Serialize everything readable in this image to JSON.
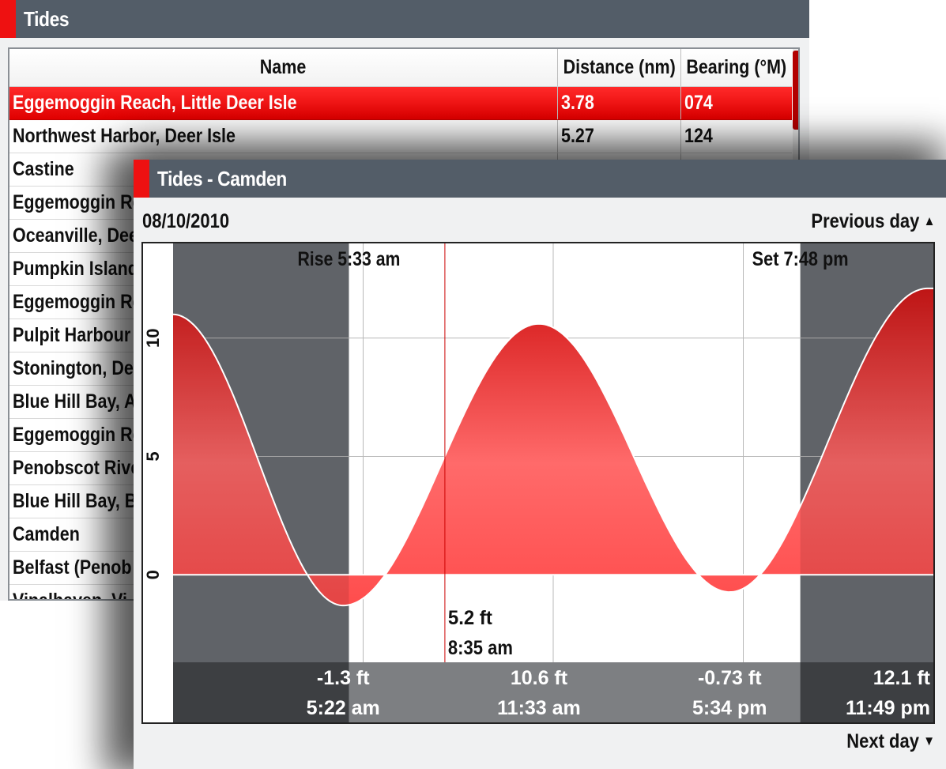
{
  "list_window": {
    "title": "Tides",
    "columns": [
      "Name",
      "Distance (nm)",
      "Bearing (°M)"
    ],
    "rows": [
      {
        "name": "Eggemoggin Reach, Little Deer Isle",
        "distance": "3.78",
        "bearing": "074",
        "selected": true
      },
      {
        "name": "Northwest Harbor, Deer Isle",
        "distance": "5.27",
        "bearing": "124"
      },
      {
        "name": "Castine",
        "distance": "",
        "bearing": ""
      },
      {
        "name": "Eggemoggin Re",
        "distance": "",
        "bearing": ""
      },
      {
        "name": "Oceanville, Dee",
        "distance": "",
        "bearing": ""
      },
      {
        "name": "Pumpkin Island",
        "distance": "",
        "bearing": ""
      },
      {
        "name": "Eggemoggin Re",
        "distance": "",
        "bearing": ""
      },
      {
        "name": "Pulpit Harbour",
        "distance": "",
        "bearing": ""
      },
      {
        "name": "Stonington, De",
        "distance": "",
        "bearing": ""
      },
      {
        "name": "Blue Hill Bay, A",
        "distance": "",
        "bearing": ""
      },
      {
        "name": "Eggemoggin Re",
        "distance": "",
        "bearing": ""
      },
      {
        "name": "Penobscot Rive",
        "distance": "",
        "bearing": ""
      },
      {
        "name": "Blue Hill Bay, B",
        "distance": "",
        "bearing": ""
      },
      {
        "name": "Camden",
        "distance": "",
        "bearing": ""
      },
      {
        "name": "Belfast (Penob",
        "distance": "",
        "bearing": ""
      },
      {
        "name": "Vinalhaven, Vi",
        "distance": "",
        "bearing": ""
      }
    ],
    "colors": {
      "titlebar": "#535d68",
      "accent": "#ee1111",
      "selected_row": "#ff1a1a"
    }
  },
  "detail_window": {
    "title": "Tides - Camden",
    "date": "08/10/2010",
    "previous_day_label": "Previous day",
    "next_day_label": "Next day",
    "icons": {
      "previous": "triangle-up-icon",
      "next": "triangle-down-icon"
    }
  },
  "chart_data": {
    "type": "area",
    "x_unit": "hour of day",
    "y_unit": "ft",
    "xlim": [
      0,
      24
    ],
    "ylim": [
      -3.7,
      14
    ],
    "yticks": [
      0,
      5,
      10
    ],
    "grid": true,
    "extremes": [
      {
        "hour": 0.0,
        "value": 11.0
      },
      {
        "hour": 5.37,
        "value": -1.3,
        "value_label": "-1.3 ft",
        "time_label": "5:22 am"
      },
      {
        "hour": 11.55,
        "value": 10.6,
        "value_label": "10.6 ft",
        "time_label": "11:33 am"
      },
      {
        "hour": 17.57,
        "value": -0.73,
        "value_label": "-0.73 ft",
        "time_label": "5:34 pm"
      },
      {
        "hour": 23.82,
        "value": 12.1,
        "value_label": "12.1 ft",
        "time_label": "11:49 pm"
      },
      {
        "hour": 24.0,
        "value": 12.1
      }
    ],
    "sunrise": {
      "hour": 5.55,
      "label": "Rise 5:33 am"
    },
    "sunset": {
      "hour": 19.8,
      "label": "Set 7:48 pm"
    },
    "cursor": {
      "hour": 8.58,
      "value_label": "5.2 ft",
      "time_label": "8:35 am"
    },
    "colors": {
      "night": "#6b6f74",
      "day": "#ffffff",
      "tide_fill": "#ff5555",
      "curve": "#ffffff",
      "cursor": "#cc0000",
      "footer_dark": "#3d3f42",
      "footer_light": "#7d7f82"
    }
  }
}
